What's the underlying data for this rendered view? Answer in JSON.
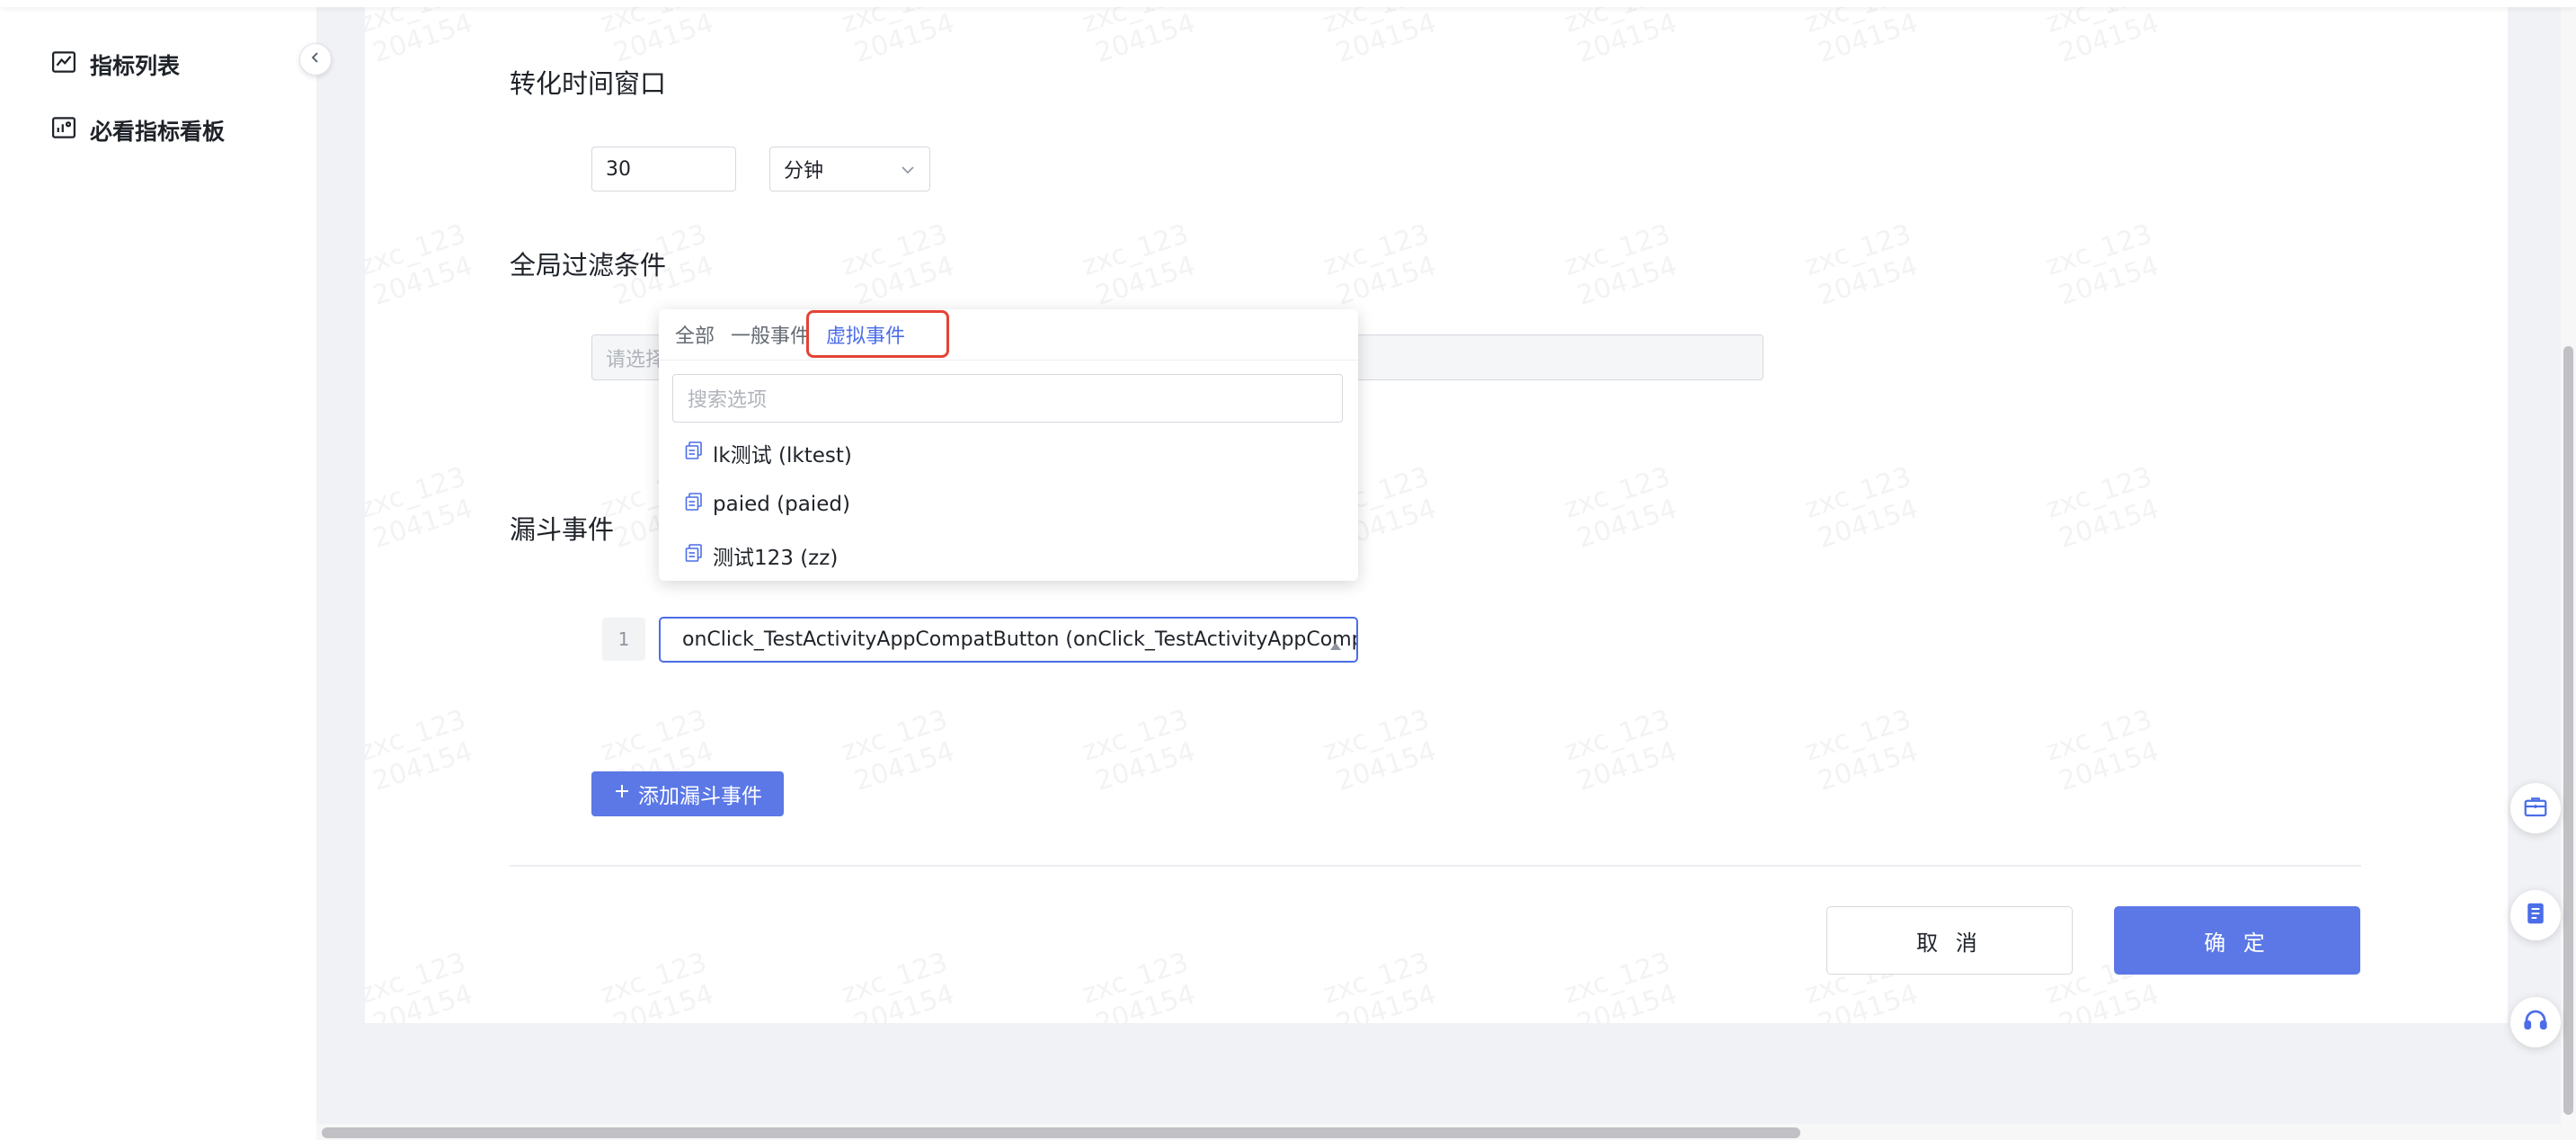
{
  "sidebar": {
    "items": [
      {
        "label": "指标列表",
        "icon": "line-chart-icon"
      },
      {
        "label": "必看指标看板",
        "icon": "dashboard-icon"
      }
    ],
    "collapse_icon": "chevron-left-icon"
  },
  "watermark": {
    "line1": "zxc_123",
    "line2": "204154"
  },
  "form": {
    "time_window": {
      "title": "转化时间窗口",
      "value": "30",
      "unit": "分钟"
    },
    "global_filter": {
      "title": "全局过滤条件",
      "placeholder": "请选择"
    },
    "funnel": {
      "title": "漏斗事件",
      "steps": [
        {
          "index": "1",
          "value": "onClick_TestActivityAppCompatButton (onClick_TestActivityAppCompatButton)"
        }
      ],
      "add_label": "添加漏斗事件"
    }
  },
  "dropdown": {
    "tabs": [
      {
        "label": "全部",
        "active": false
      },
      {
        "label": "一般事件",
        "active": false
      },
      {
        "label": "虚拟事件",
        "active": true
      }
    ],
    "search_placeholder": "搜索选项",
    "options": [
      {
        "label": "lk测试 (lktest)"
      },
      {
        "label": "paied (paied)"
      },
      {
        "label": "测试123 (zz)"
      }
    ],
    "accent": "#4b6de8",
    "highlight_color": "#e44335"
  },
  "actions": {
    "cancel": "取 消",
    "confirm": "确 定",
    "primary_color": "#5b78e6"
  },
  "floating": [
    "toolbox-icon",
    "document-icon",
    "headset-icon"
  ]
}
